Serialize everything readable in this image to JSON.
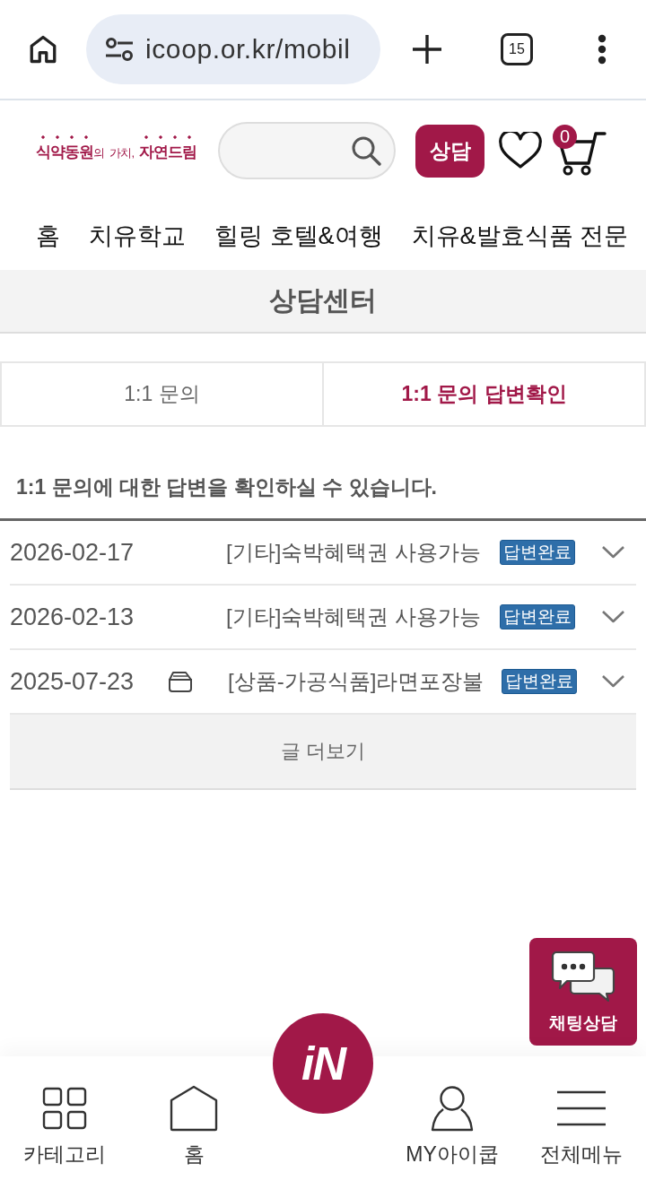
{
  "browser": {
    "url": "icoop.or.kr/mobil",
    "tab_count": "15"
  },
  "header": {
    "logo": "**식약동원**의 가치, **자연드림**",
    "consult_button": "상담",
    "cart_count": "0"
  },
  "nav": [
    "홈",
    "치유학교",
    "힐링 호텔&여행",
    "치유&발효식품 전문"
  ],
  "page_title": "상담센터",
  "tabs": [
    {
      "label": "1:1 문의",
      "selected": false
    },
    {
      "label": "1:1 문의 답변확인",
      "selected": true
    }
  ],
  "description": "1:1 문의에 대한 답변을 확인하실 수 있습니다.",
  "inquiries": [
    {
      "date": "2026-02-17",
      "box_icon": false,
      "title": "[기타]숙박혜택권 사용가능",
      "status": "답변완료",
      "expanded": false
    },
    {
      "date": "2026-02-13",
      "box_icon": false,
      "title": "[기타]숙박혜택권 사용가능",
      "status": "답변완료",
      "expanded": false
    },
    {
      "date": "2025-07-23",
      "box_icon": true,
      "title": "[상품-가공식품]라면포장불",
      "status": "답변완료",
      "expanded": false
    }
  ],
  "more_button": "글 더보기",
  "chat_button": "채팅상담",
  "bottom_nav": [
    {
      "label": "카테고리",
      "kind": "grid"
    },
    {
      "label": "홈",
      "kind": "home"
    },
    {
      "label": "iN",
      "kind": "logo"
    },
    {
      "label": "MY아이쿱",
      "kind": "person"
    },
    {
      "label": "전체메뉴",
      "kind": "menu"
    }
  ]
}
